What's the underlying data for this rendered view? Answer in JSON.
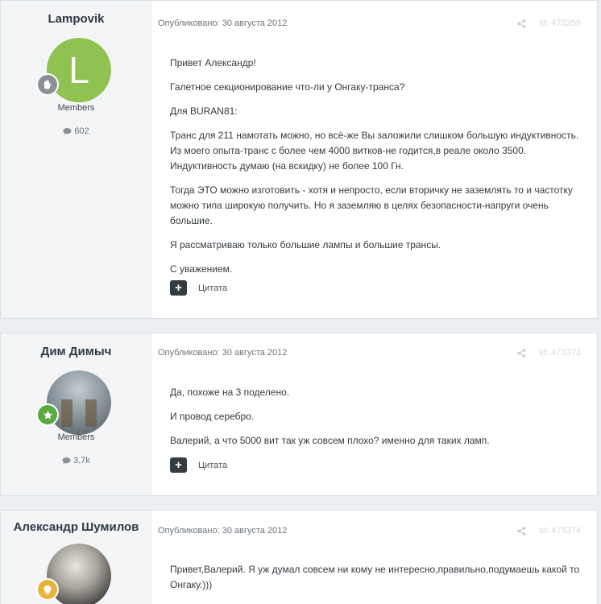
{
  "posts": [
    {
      "author": "Lampovik",
      "avatar_letter": "L",
      "group": "Members",
      "count": "602",
      "published": "Опубликовано: 30 августа 2012",
      "post_id": "Id: 473359",
      "paragraphs": [
        "Привет Александр!",
        "Галетное секционирование что-ли у Онгаку-транса?",
        "Для BURAN81:",
        "Транс для 211 намотать можно, но всё-же Вы заложили слишком большую индуктивность. Из моего опыта-транс с более чем 4000 витков-не годится,в реале около 3500. Индуктивность думаю (на вскидку) не более 100 Гн.",
        "Тогда ЭТО можно изготовить - хотя и непросто, если вторичку не заземлять то и частотку можно типа широкую получить. Но я заземляю в целях безопасности-напруги очень большие.",
        "Я рассматриваю только большие лампы и большие трансы.",
        "С уважением."
      ],
      "quote_label": "Цитата"
    },
    {
      "author": "Дим Димыч",
      "group": "Members",
      "count": "3,7k",
      "published": "Опубликовано: 30 августа 2012",
      "post_id": "Id: 473373",
      "paragraphs": [
        "Да, похоже на 3 поделено.",
        "И провод серебро.",
        "Валерий, а что 5000 вит так уж совсем плохо? именно для таких ламп."
      ],
      "quote_label": "Цитата"
    },
    {
      "author": "Александр Шумилов",
      "published": "Опубликовано: 30 августа 2012",
      "post_id": "Id: 473374",
      "paragraphs": [
        "Привет,Валерий. Я уж думал совсем ни кому не интересно,правильно,подумаешь какой то Онгаку.)))"
      ]
    }
  ],
  "colors": {
    "avatar_green": "#8fc250",
    "badge_green": "#5ba941",
    "badge_grey": "#8a9096",
    "badge_yellow": "#e6b43a",
    "quote_button": "#353c41"
  },
  "icons": {
    "rank_1": "hand-icon",
    "rank_2": "star-icon",
    "rank_3": "lightbulb-icon",
    "share": "share-icon",
    "count": "comment-icon",
    "quote": "plus-icon"
  }
}
